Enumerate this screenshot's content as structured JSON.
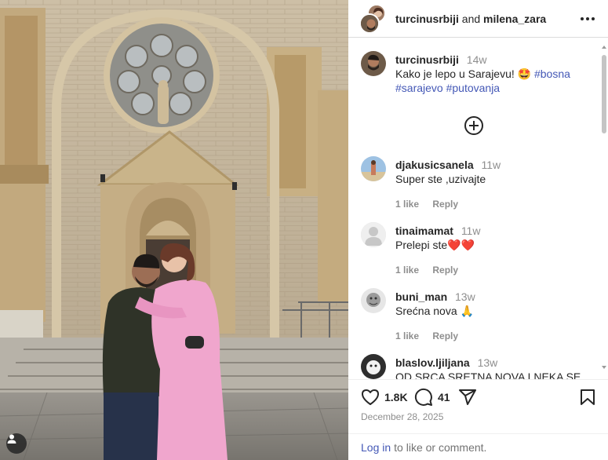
{
  "header": {
    "user1": "turcinusrbiji",
    "conjunction": "and",
    "user2": "milena_zara",
    "more_icon": "more-horizontal-icon"
  },
  "caption": {
    "username": "turcinusrbiji",
    "time": "14w",
    "text": "Kako je lepo u Sarajevu! 🤩",
    "hashtags": [
      "#bosna",
      "#sarajevo",
      "#putovanja"
    ]
  },
  "load_more_icon": "plus-circle-icon",
  "comments": [
    {
      "username": "djakusicsanela",
      "time": "11w",
      "text": "Super ste ,uzivajte",
      "likes": "1 like",
      "reply": "Reply"
    },
    {
      "username": "tinaimamat",
      "time": "11w",
      "text": "Prelepi ste❤️❤️",
      "likes": "1 like",
      "reply": "Reply"
    },
    {
      "username": "buni_man",
      "time": "13w",
      "text": "Srećna nova 🙏",
      "likes": "1 like",
      "reply": "Reply"
    },
    {
      "username": "blaslov.ljiljana",
      "time": "13w",
      "text": "OD SRCA SRETNA NOVA I NEKA SE SVE",
      "likes": "",
      "reply": ""
    }
  ],
  "actions": {
    "like_count": "1.8K",
    "comment_count": "41",
    "icons": [
      "heart-icon",
      "comment-icon",
      "share-icon",
      "bookmark-icon"
    ]
  },
  "post_date": "December 28, 2025",
  "footer": {
    "login_label": "Log in",
    "rest": "to like or comment."
  },
  "colors": {
    "link": "#4458b6",
    "muted": "#8e8e8e",
    "text": "#262626",
    "coat": "#f1a7cf",
    "stone": "#c9b79b"
  }
}
